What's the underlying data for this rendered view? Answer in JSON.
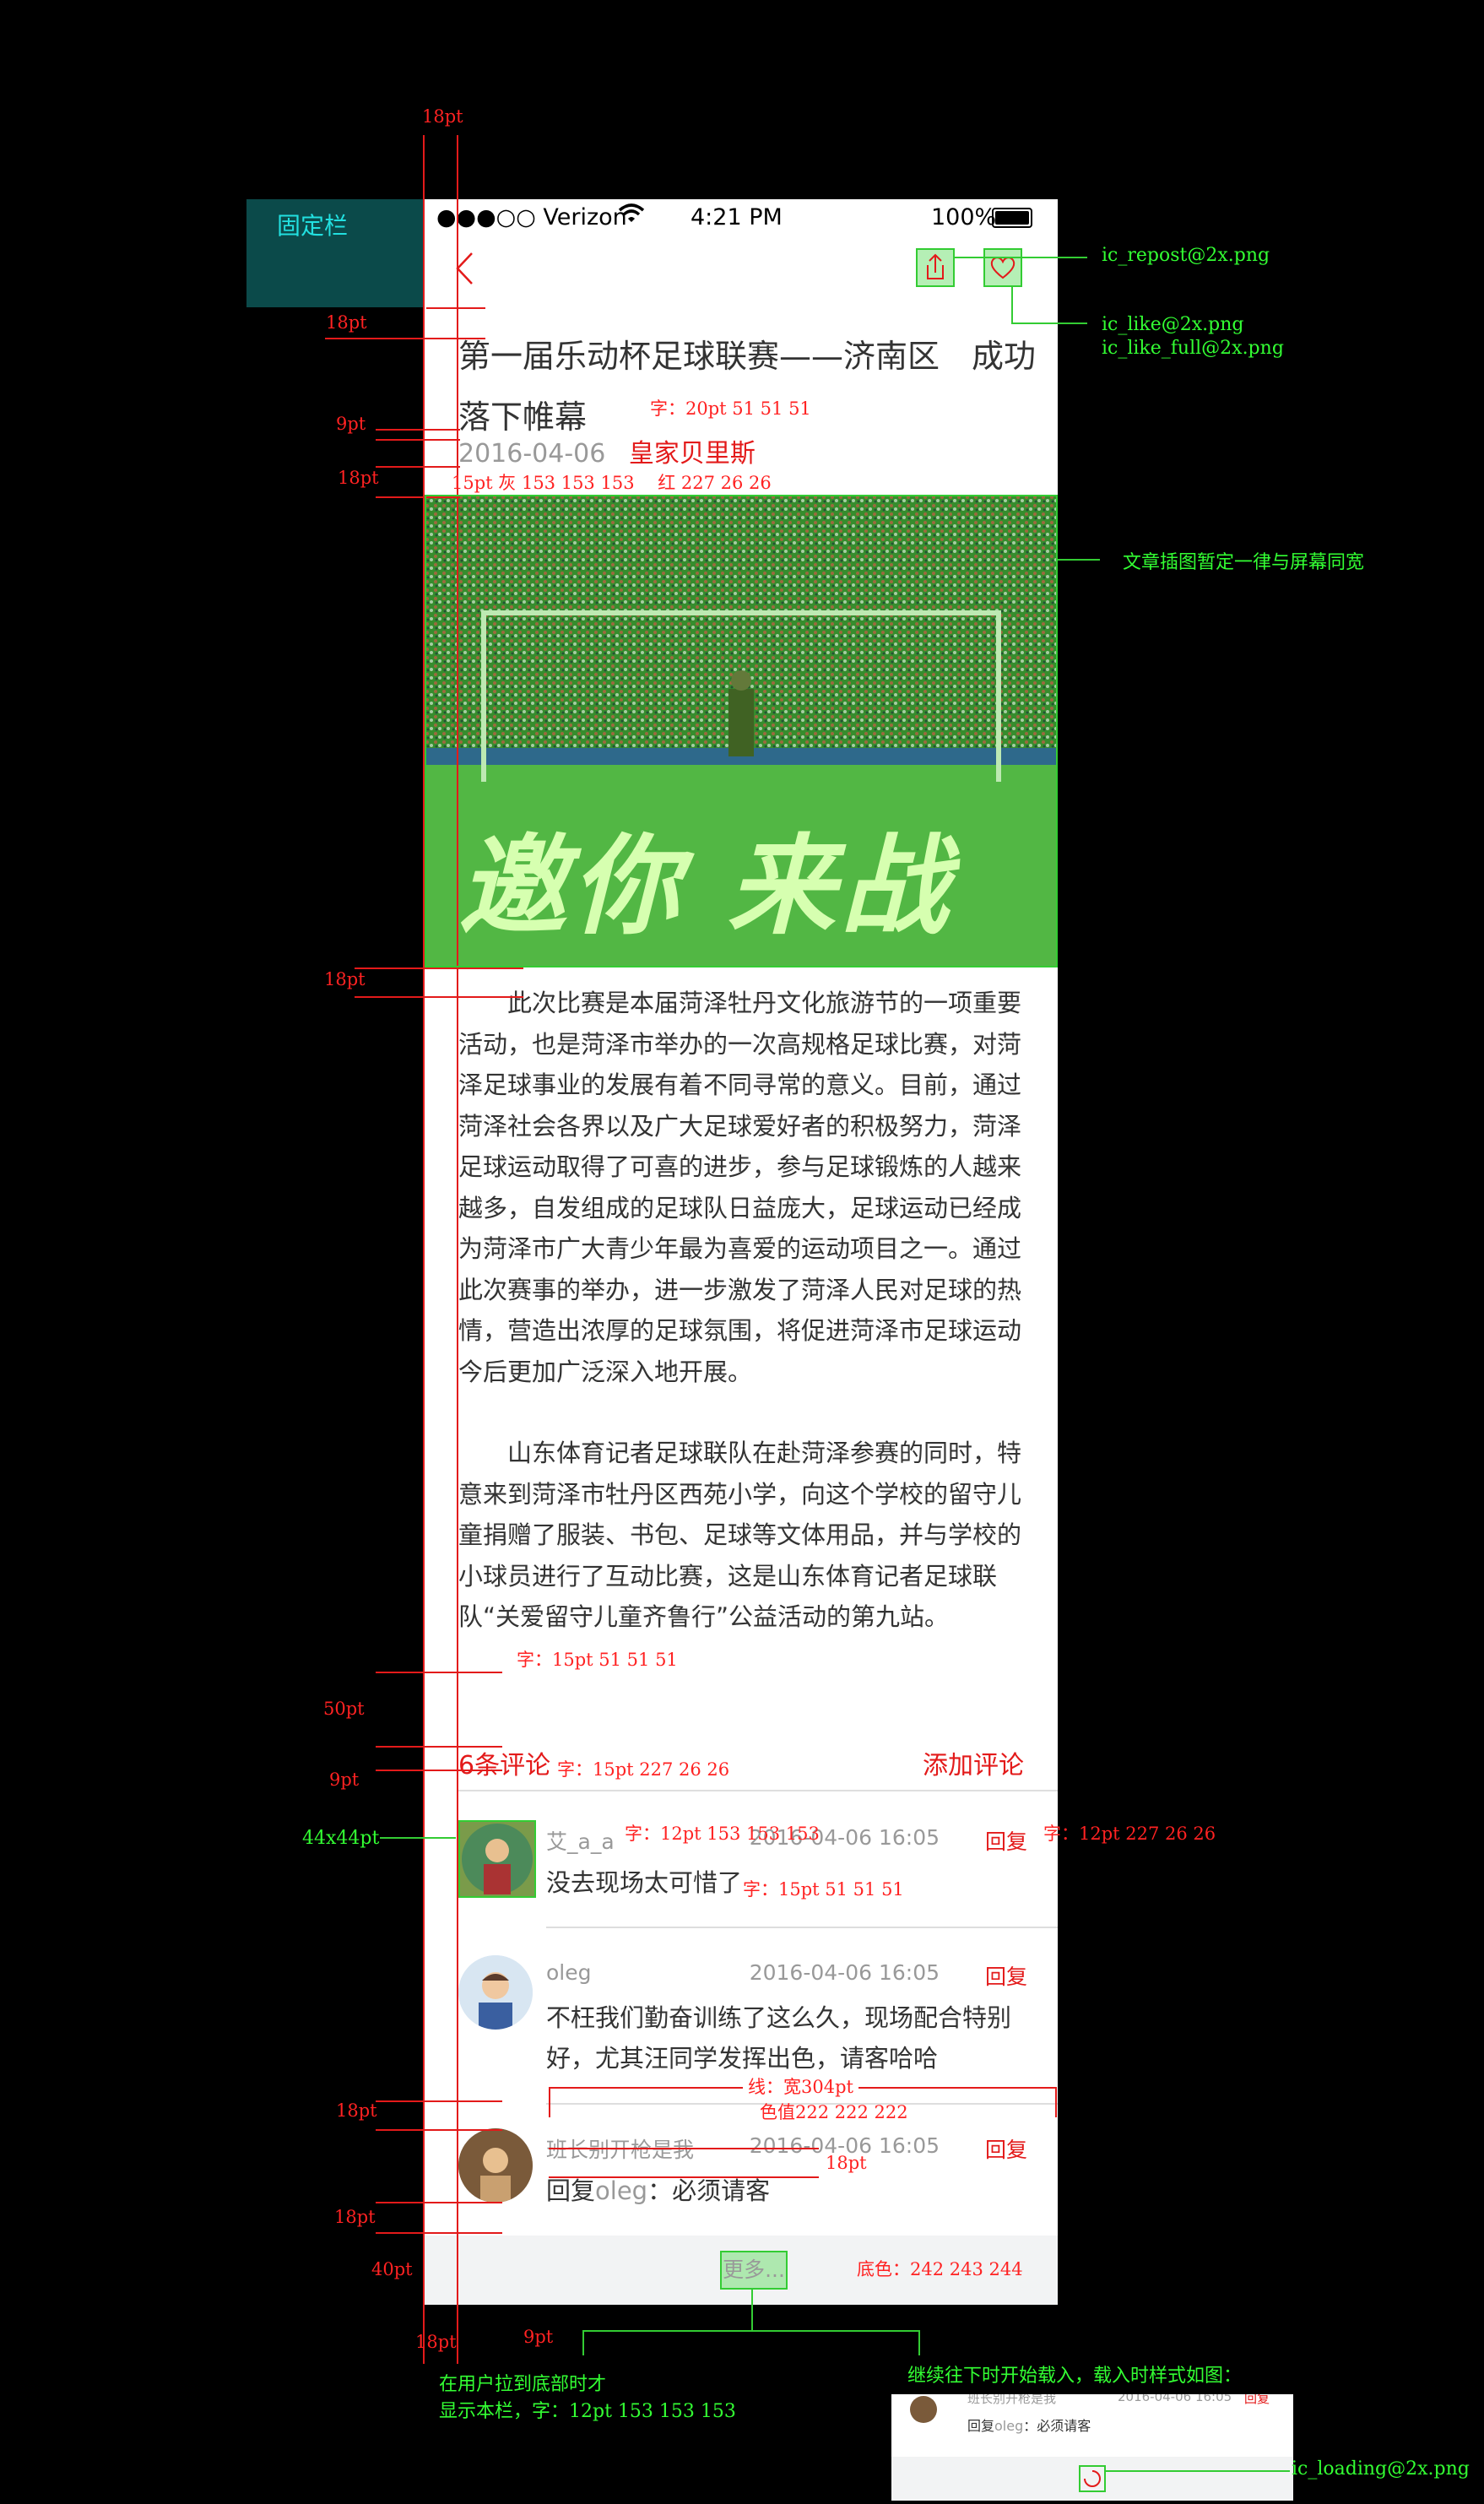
{
  "fixed_bar_label": "固定栏",
  "status_bar": {
    "carrier": "●●●○○ Verizon",
    "time": "4:21 PM",
    "battery": "100%"
  },
  "article": {
    "title": "第一届乐动杯足球联赛——济南区　成功落下帷幕",
    "date": "2016-04-06",
    "author": "皇家贝里斯",
    "hero_text": "邀你 来战",
    "paragraph1": "　　此次比赛是本届菏泽牡丹文化旅游节的一项重要活动，也是菏泽市举办的一次高规格足球比赛，对菏泽足球事业的发展有着不同寻常的意义。目前，通过菏泽社会各界以及广大足球爱好者的积极努力，菏泽足球运动取得了可喜的进步，参与足球锻炼的人越来越多，自发组成的足球队日益庞大，足球运动已经成为菏泽市广大青少年最为喜爱的运动项目之一。通过此次赛事的举办，进一步激发了菏泽人民对足球的热情，营造出浓厚的足球氛围，将促进菏泽市足球运动今后更加广泛深入地开展。",
    "paragraph2": "　　山东体育记者足球联队在赴菏泽参赛的同时，特意来到菏泽市牡丹区西苑小学，向这个学校的留守儿童捐赠了服装、书包、足球等文体用品，并与学校的小球员进行了互动比赛，这是山东体育记者足球联队“关爱留守儿童齐鲁行”公益活动的第九站。"
  },
  "comments_header": {
    "count": "6条评论",
    "add": "添加评论"
  },
  "comments": [
    {
      "name": "艾_a_a",
      "time": "2016-04-06  16:05",
      "reply": "回复",
      "text": "没去现场太可惜了"
    },
    {
      "name": "oleg",
      "time": "2016-04-06  16:05",
      "reply": "回复",
      "text": "不枉我们勤奋训练了这么久，现场配合特别好，尤其汪同学发挥出色，请客哈哈"
    },
    {
      "name": "班长别开枪是我",
      "time": "2016-04-06  16:05",
      "reply": "回复",
      "text_prefix": "回复",
      "text_target": "oleg",
      "text_body": "：必须请客"
    }
  ],
  "more_label": "更多...",
  "annotations": {
    "top_margin": "18pt",
    "title_margin": "18pt",
    "title_spec": "字：20pt 51 51 51",
    "meta_gap": "9pt",
    "meta_margin": "18pt",
    "meta_spec": "15pt 灰 153 153 153　 红 227 26 26",
    "image_margin": "18pt",
    "image_note": "文章插图暂定一律与屏幕同宽",
    "body_spec": "字：15pt 51 51 51",
    "comments_gap": "50pt",
    "comments_head_gap": "9pt",
    "comments_head_spec": "字：15pt 227 26 26",
    "avatar_size": "44x44pt",
    "name_spec": "字：12pt 153 153 153",
    "reply_spec": "字：12pt 227 26 26",
    "comment_spec": "字：15pt 51 51 51",
    "line_spec_1": "线：宽304pt",
    "line_spec_2": "色值222 222 222",
    "comment_gap1": "18pt",
    "comment_gap2": "18pt",
    "reply_gap": "18pt",
    "bottom_gap": "40pt",
    "left_margin": "18pt",
    "inner_margin": "9pt",
    "more_bg": "底色：242 243 244",
    "more_note_1": "在用户拉到底部时才",
    "more_note_2": "显示本栏，字：12pt 153 153 153",
    "loading_note": "继续往下时开始载入，载入时样式如图：",
    "repost_icon": "ic_repost@2x.png",
    "like_icon": "ic_like@2x.png",
    "like_full_icon": "ic_like_full@2x.png",
    "loading_icon": "ic_loading@2x.png",
    "preview_name": "班长别开枪是我",
    "preview_time": "2016-04-06  16:05",
    "preview_reply": "回复",
    "preview_text_prefix": "回复",
    "preview_text_target": "oleg",
    "preview_text_body": "：必须请客"
  },
  "colors": {
    "accent_red": "#e31a1a",
    "text_dark": "#333333",
    "text_gray": "#999999",
    "divider": "#dedede",
    "more_bg": "#f2f3f4",
    "annotation_green": "#33ff33"
  }
}
